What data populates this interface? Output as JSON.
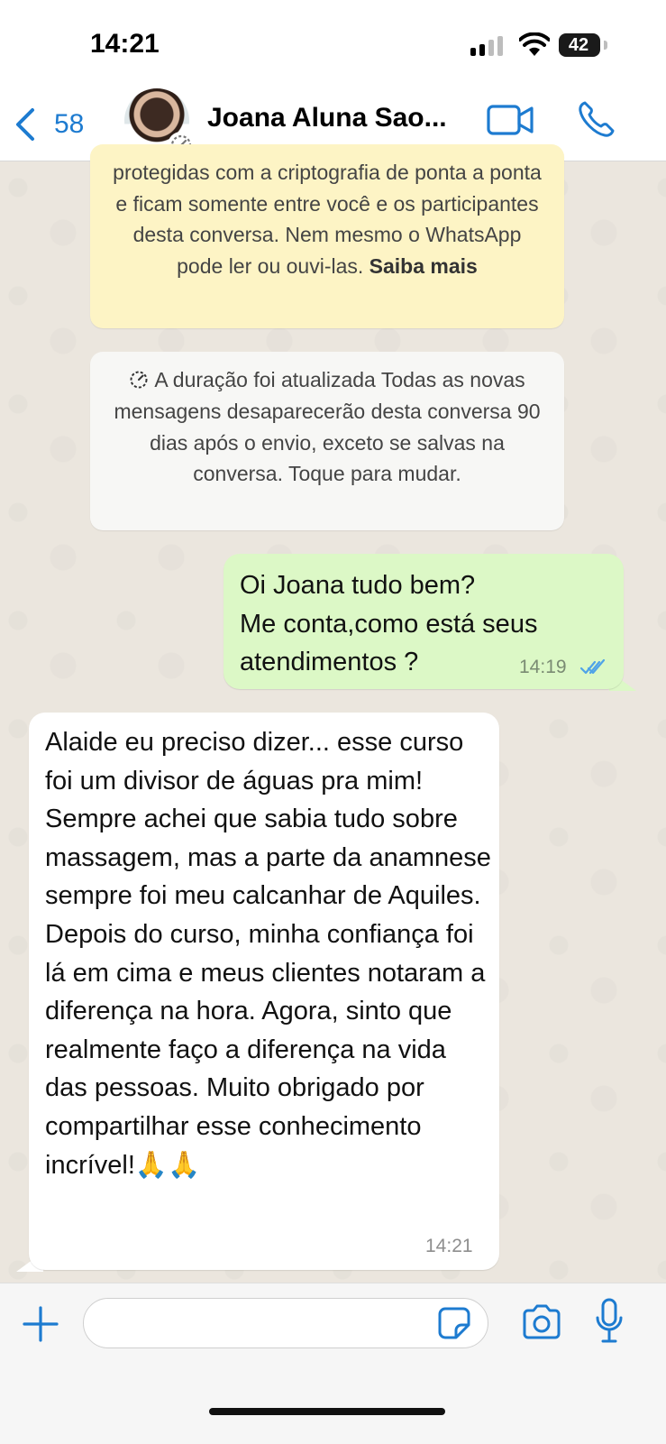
{
  "status_bar": {
    "time": "14:21",
    "battery": "42"
  },
  "header": {
    "back_count": "58",
    "contact_name": "Joana Aluna Sao...",
    "accent_color": "#1d7bd0"
  },
  "banners": {
    "encryption_text": "protegidas com a criptografia de ponta a ponta e ficam somente entre você e os participantes desta conversa. Nem mesmo o WhatsApp pode ler ou ouvi-las.",
    "encryption_link": "Saiba mais",
    "timer_text": "A duração foi atualizada Todas as novas mensagens desaparecerão desta conversa 90 dias após o envio, exceto se salvas na conversa. Toque para mudar."
  },
  "messages": [
    {
      "direction": "outgoing",
      "text": "Oi Joana tudo bem?\nMe conta,como está seus atendimentos ?",
      "time": "14:19",
      "status": "read"
    },
    {
      "direction": "incoming",
      "text": "Alaide eu preciso dizer... esse curso foi um divisor de águas pra mim! Sempre achei que sabia tudo sobre massagem, mas a parte da anamnese sempre foi meu calcanhar de Aquiles. Depois do curso, minha confiança foi lá em cima e meus clientes notaram a diferença na hora. Agora, sinto que realmente faço a diferença na vida das pessoas. Muito obrigado por compartilhar esse conhecimento incrível!🙏🙏",
      "time": "14:21"
    }
  ],
  "input": {
    "value": "",
    "placeholder": ""
  }
}
